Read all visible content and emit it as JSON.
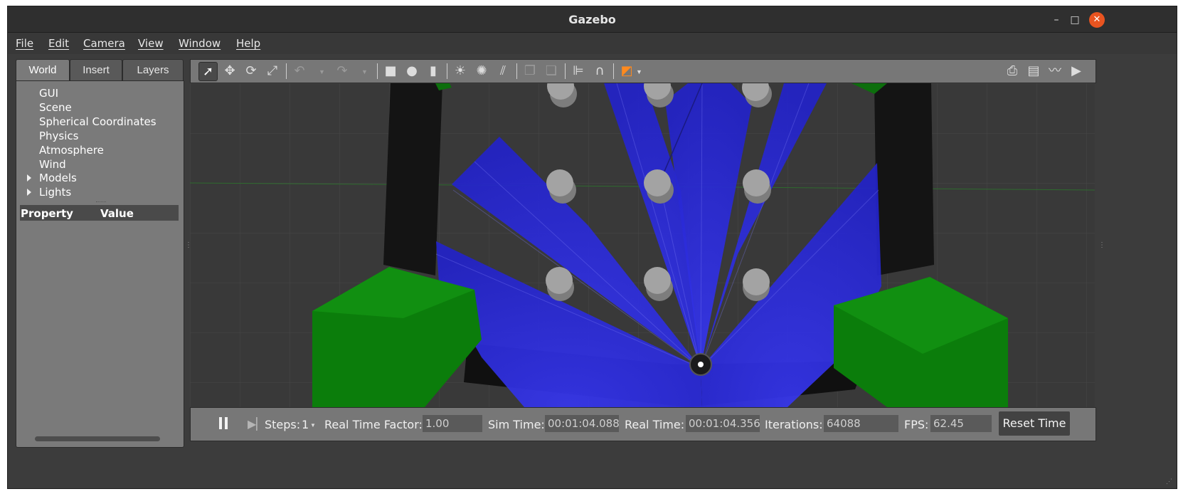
{
  "window": {
    "title": "Gazebo",
    "minimize": "–",
    "maximize": "□",
    "close": "✕"
  },
  "menu": [
    "File",
    "Edit",
    "Camera",
    "View",
    "Window",
    "Help"
  ],
  "left_panel": {
    "tabs": [
      "World",
      "Insert",
      "Layers"
    ],
    "active_tab": "World",
    "tree": [
      "GUI",
      "Scene",
      "Spherical Coordinates",
      "Physics",
      "Atmosphere",
      "Wind",
      "Models",
      "Lights"
    ],
    "property_header": {
      "property": "Property",
      "value": "Value"
    }
  },
  "toolbar": {
    "icons": [
      "select-arrow-icon",
      "translate-icon",
      "rotate-icon",
      "scale-icon",
      "undo-icon",
      "redo-icon",
      "box-icon",
      "sphere-icon",
      "cylinder-icon",
      "point-light-icon",
      "spot-light-icon",
      "directional-light-icon",
      "copy-icon",
      "paste-icon",
      "align-icon",
      "snap-magnet-icon",
      "view-angle-icon",
      "screenshot-icon",
      "log-icon",
      "plot-icon",
      "video-record-icon"
    ]
  },
  "status": {
    "steps_label": "Steps:",
    "steps_value": "1",
    "rtf_label": "Real Time Factor:",
    "rtf_value": "1.00",
    "sim_time_label": "Sim Time:",
    "sim_time_value": "00:01:04.088",
    "real_time_label": "Real Time:",
    "real_time_value": "00:01:04.356",
    "iterations_label": "Iterations:",
    "iterations_value": "64088",
    "fps_label": "FPS:",
    "fps_value": "62.45",
    "reset_label": "Reset Time"
  },
  "colors": {
    "laser": "#2b2bd6",
    "obstacle_green": "#0b7d0b",
    "wall": "#101010",
    "pillar": "#8f8f8f",
    "accent_orange": "#e95420"
  }
}
